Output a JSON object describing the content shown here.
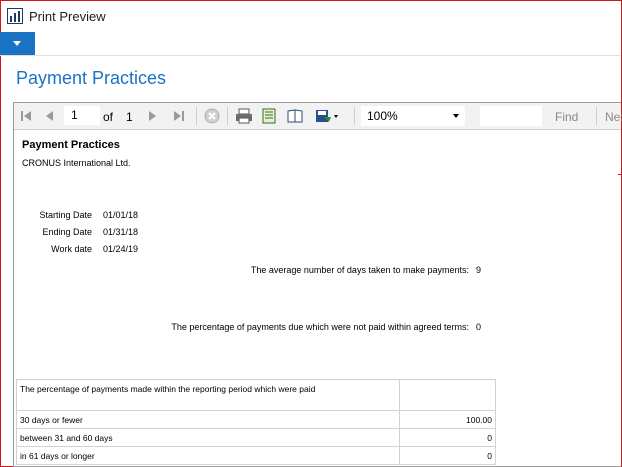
{
  "window": {
    "title": "Print Preview"
  },
  "page": {
    "title": "Payment Practices"
  },
  "toolbar": {
    "current_page": "1",
    "of_label": "of",
    "total_pages": "1",
    "zoom": "100%",
    "find_label": "Find",
    "next_label": "Next"
  },
  "report": {
    "title": "Payment Practices",
    "company": "CRONUS International Ltd.",
    "fields": [
      {
        "label": "Starting Date",
        "value": "01/01/18"
      },
      {
        "label": "Ending Date",
        "value": "01/31/18"
      },
      {
        "label": "Work date",
        "value": "01/24/19"
      }
    ],
    "avg_days": {
      "label": "The average number of days taken to make payments:",
      "value": "9"
    },
    "not_paid_pct": {
      "label": "The percentage of payments due which were not paid within agreed terms:",
      "value": "0"
    },
    "table": {
      "header": "The percentage of payments made within the reporting period which were paid",
      "rows": [
        {
          "label": "30 days or fewer",
          "value": "100.00"
        },
        {
          "label": "between 31 and 60 days",
          "value": "0"
        },
        {
          "label": "in 61 days or longer",
          "value": "0"
        }
      ]
    }
  },
  "colors": {
    "accent": "#1b73c6",
    "border_red": "#d4141b"
  }
}
